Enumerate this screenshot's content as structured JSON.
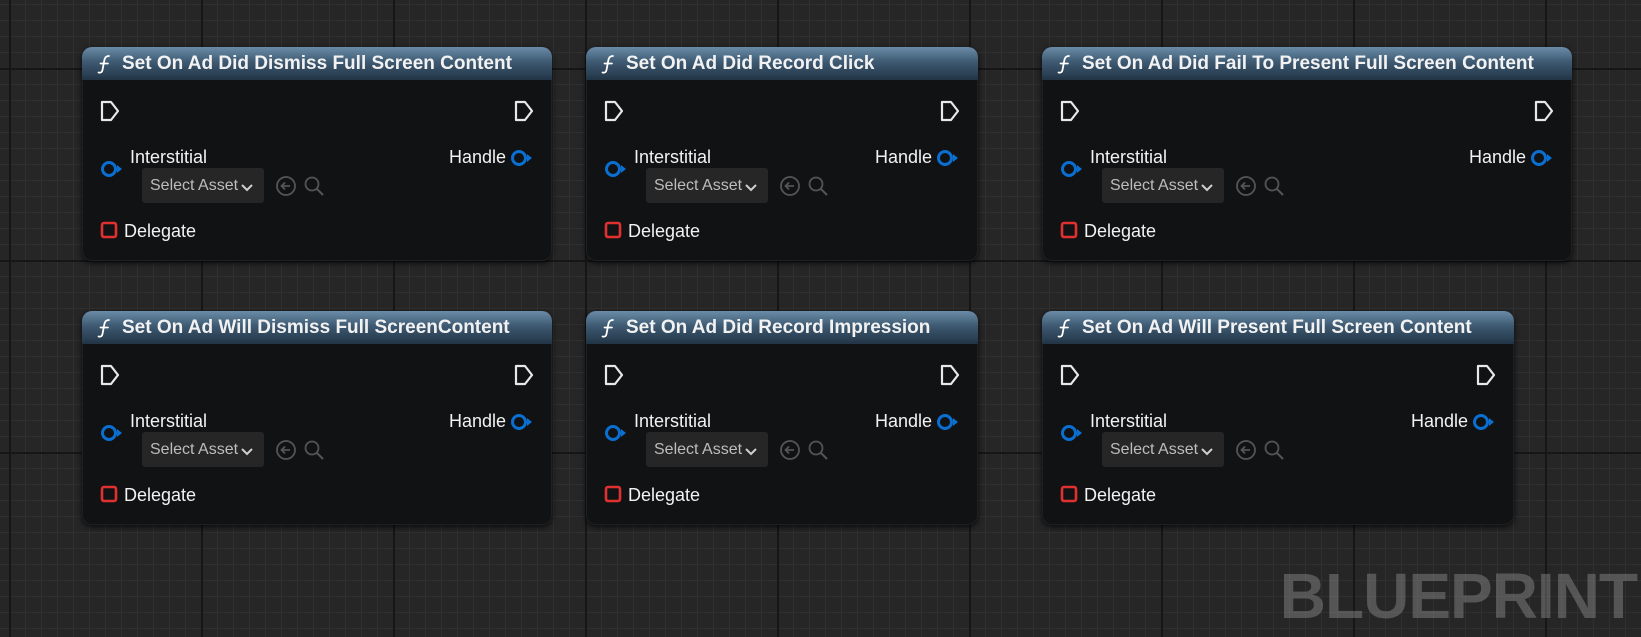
{
  "colors": {
    "header_gradient_top": "#6a8ca8",
    "header_gradient_bottom": "#223445",
    "object_pin": "#0a6fd0",
    "delegate_pin": "#e03030",
    "exec_pin": "#e8e8e8",
    "node_body": "#101213"
  },
  "icons": {
    "function": "function-icon",
    "exec": "exec-pin-icon",
    "object_pin": "object-pin-icon",
    "delegate_pin": "delegate-pin-icon",
    "dropdown": "chevron-down-icon",
    "use_selected": "use-selected-asset-icon",
    "browse": "browse-asset-icon"
  },
  "nodes": [
    {
      "title": "Set On Ad Did Dismiss Full Screen Content",
      "target_label": "Interstitial",
      "target_value": "Select Asset",
      "output_label": "Handle",
      "delegate_label": "Delegate"
    },
    {
      "title": "Set On Ad Did Record Click",
      "target_label": "Interstitial",
      "target_value": "Select Asset",
      "output_label": "Handle",
      "delegate_label": "Delegate"
    },
    {
      "title": "Set On Ad Did Fail To Present Full Screen Content",
      "target_label": "Interstitial",
      "target_value": "Select Asset",
      "output_label": "Handle",
      "delegate_label": "Delegate"
    },
    {
      "title": "Set On Ad Will Dismiss Full ScreenContent",
      "target_label": "Interstitial",
      "target_value": "Select Asset",
      "output_label": "Handle",
      "delegate_label": "Delegate"
    },
    {
      "title": "Set On Ad Did Record Impression",
      "target_label": "Interstitial",
      "target_value": "Select Asset",
      "output_label": "Handle",
      "delegate_label": "Delegate"
    },
    {
      "title": "Set On Ad Will Present Full Screen Content",
      "target_label": "Interstitial",
      "target_value": "Select Asset",
      "output_label": "Handle",
      "delegate_label": "Delegate"
    }
  ],
  "watermark": "BLUEPRINT"
}
